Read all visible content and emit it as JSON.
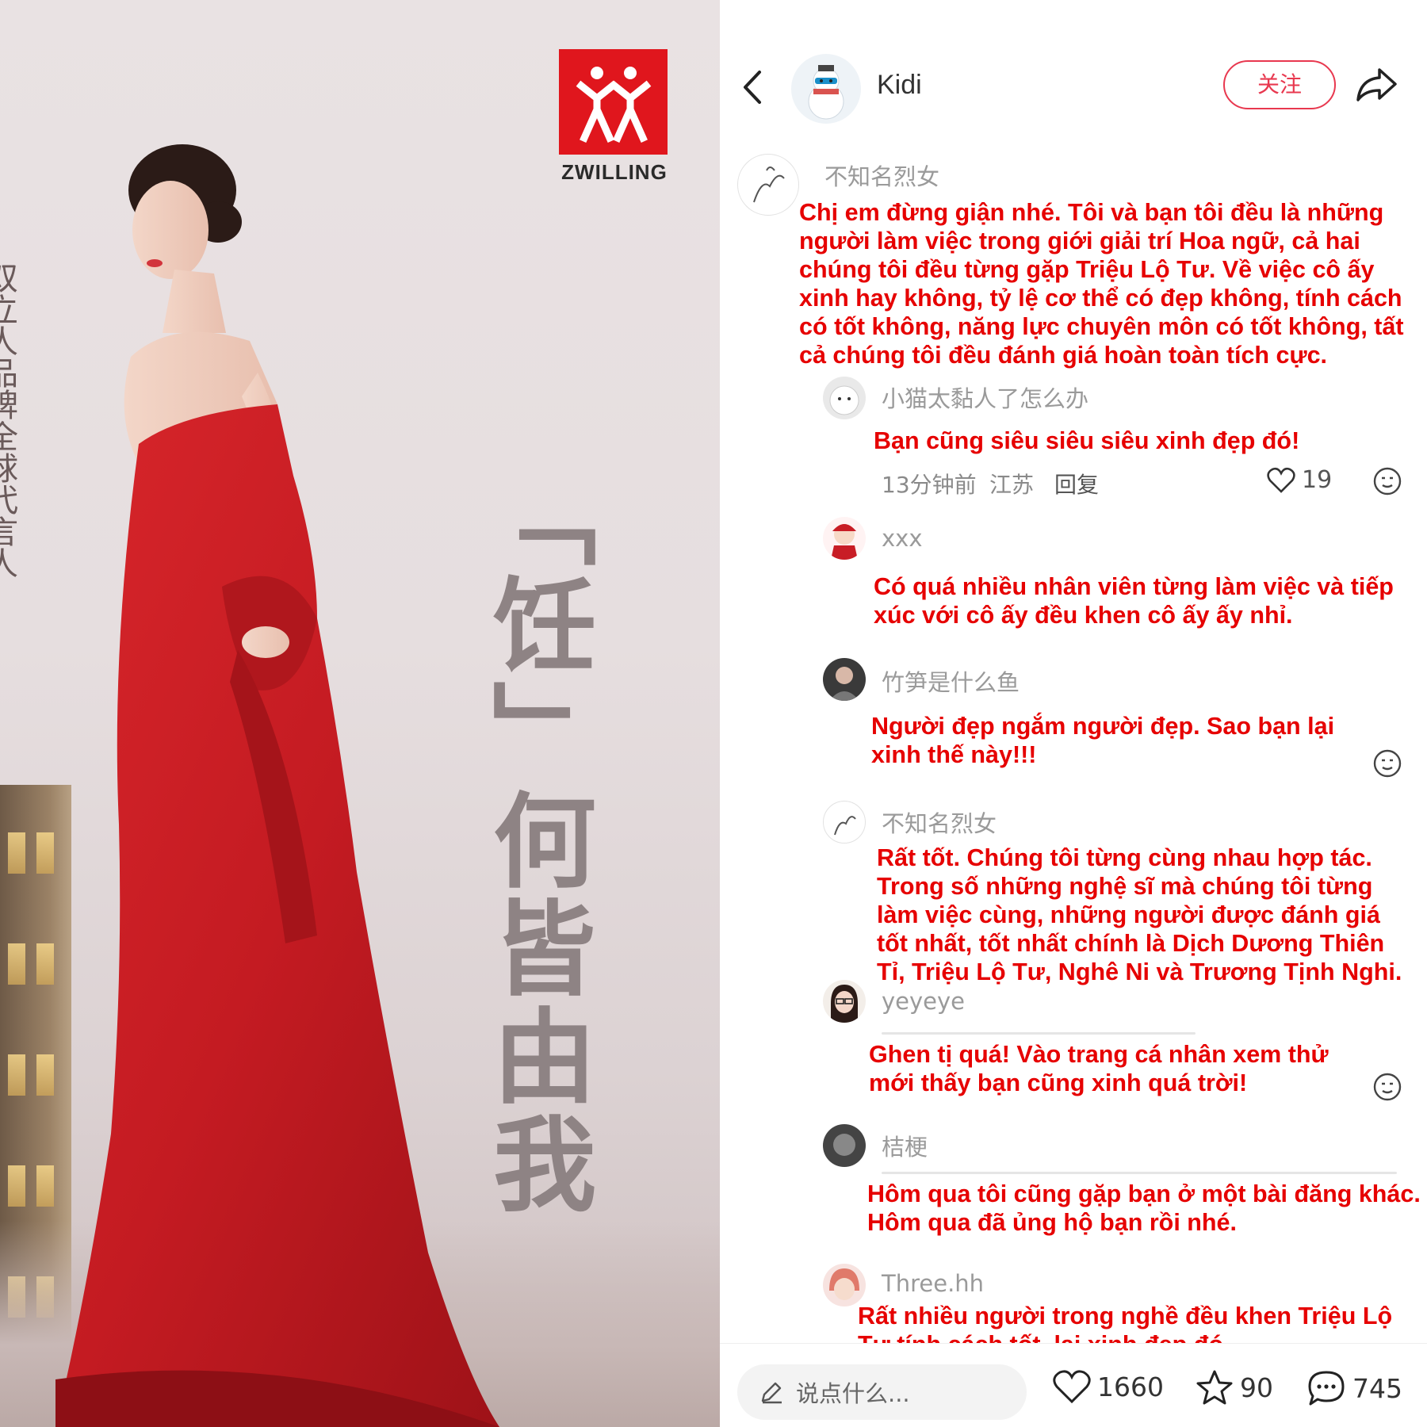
{
  "poster": {
    "brand": "ZWILLING",
    "slogan": "「饪」何皆由我",
    "vertical_text_partial": "双立人品牌全球代言人"
  },
  "header": {
    "author": "Kidi",
    "follow_label": "关注"
  },
  "comments": [
    {
      "user": "不知名烈女",
      "text": "Chị em đừng giận nhé. Tôi và bạn tôi đều là những người làm việc trong giới giải trí Hoa ngữ, cả hai chúng tôi đều từng gặp Triệu Lộ Tư. Về việc cô ấy xinh hay không, tỷ lệ cơ thể có đẹp không, tính cách có tốt không, năng lực chuyên môn có tốt không, tất cả chúng tôi đều đánh giá hoàn toàn tích cực."
    },
    {
      "user": "小猫太黏人了怎么办",
      "text": "Bạn cũng siêu siêu siêu xinh đẹp đó!",
      "time": "13分钟前",
      "location": "江苏",
      "reply_label": "回复",
      "likes": "19"
    },
    {
      "user": "xxx",
      "text": "Có quá nhiều nhân viên từng làm việc và tiếp xúc với cô ấy đều khen cô ấy ấy nhỉ."
    },
    {
      "user": "竹笋是什么鱼",
      "text": "Người đẹp ngắm người đẹp. Sao bạn lại xinh thế này!!!"
    },
    {
      "user": "不知名烈女",
      "text": "Rất tốt. Chúng tôi từng cùng nhau hợp tác. Trong số những nghệ sĩ mà chúng tôi từng làm việc cùng, những người được đánh giá tốt nhất, tốt nhất chính là Dịch Dương Thiên Tỉ, Triệu Lộ Tư, Nghê Ni và Trương Tịnh Nghi."
    },
    {
      "user": "yeyeye",
      "text": "Ghen tị quá! Vào trang cá nhân xem thử mới thấy bạn cũng xinh quá trời!"
    },
    {
      "user": "桔梗",
      "text": "Hôm qua tôi cũng gặp bạn ở một bài đăng khác. Hôm qua đã ủng hộ bạn rồi nhé."
    },
    {
      "user": "Three.hh",
      "text": "Rất nhiều người trong nghề đều khen Triệu Lộ Tư tính cách tốt, lại xinh đẹp đó."
    }
  ],
  "bottom": {
    "input_placeholder": "说点什么...",
    "likes": "1660",
    "stars": "90",
    "comments": "745"
  },
  "colors": {
    "accent": "#e8384f",
    "overlay_text": "#e60000",
    "brand_red": "#e0161d"
  }
}
